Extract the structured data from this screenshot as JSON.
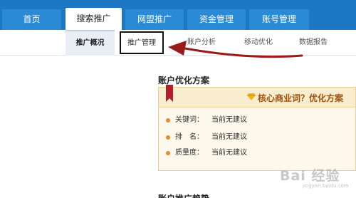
{
  "nav": {
    "tabs": [
      {
        "label": "首页"
      },
      {
        "label": "搜索推广"
      },
      {
        "label": "网盟推广"
      },
      {
        "label": "资金管理"
      },
      {
        "label": "账号管理"
      }
    ],
    "active_tab": "搜索推广"
  },
  "subnav": {
    "items": [
      {
        "label": "推广概况"
      },
      {
        "label": "推广管理"
      },
      {
        "label": "账户分析"
      },
      {
        "label": "移动优化"
      },
      {
        "label": "数据报告"
      }
    ],
    "active_item": "推广概况",
    "highlighted_item": "推广管理"
  },
  "content": {
    "section_title": "账户优化方案",
    "panel": {
      "title": "核心商业词？优化方案",
      "rows": [
        {
          "label": "关键词：",
          "value": "当前无建议"
        },
        {
          "label": "排　名：",
          "value": "当前无建议"
        },
        {
          "label": "质量度：",
          "value": "当前无建议"
        }
      ]
    },
    "next_section_title": "账户推广趋势"
  },
  "watermark": {
    "text": "Bai 经验",
    "subtext": "jingyan.baidu.com"
  },
  "colors": {
    "nav_bg": "#1c78c4",
    "tab_bg": "#2a8ad6",
    "panel_bg": "#fdf8ec",
    "panel_title": "#a0520b",
    "dot": "#e8892a",
    "arrow": "#9b1a1a"
  }
}
